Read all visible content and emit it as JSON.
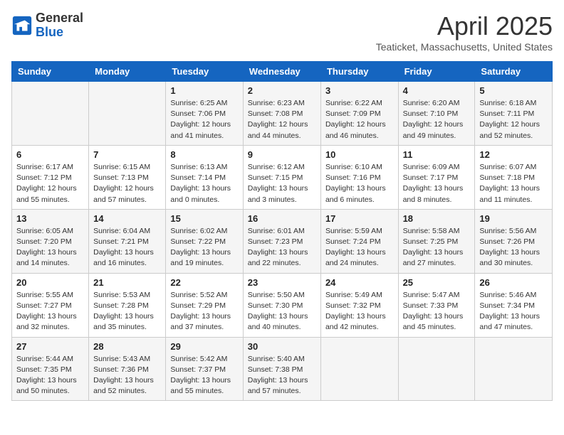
{
  "header": {
    "logo_general": "General",
    "logo_blue": "Blue",
    "month_title": "April 2025",
    "location": "Teaticket, Massachusetts, United States"
  },
  "days_of_week": [
    "Sunday",
    "Monday",
    "Tuesday",
    "Wednesday",
    "Thursday",
    "Friday",
    "Saturday"
  ],
  "weeks": [
    [
      {
        "day": "",
        "info": ""
      },
      {
        "day": "",
        "info": ""
      },
      {
        "day": "1",
        "info": "Sunrise: 6:25 AM\nSunset: 7:06 PM\nDaylight: 12 hours\nand 41 minutes."
      },
      {
        "day": "2",
        "info": "Sunrise: 6:23 AM\nSunset: 7:08 PM\nDaylight: 12 hours\nand 44 minutes."
      },
      {
        "day": "3",
        "info": "Sunrise: 6:22 AM\nSunset: 7:09 PM\nDaylight: 12 hours\nand 46 minutes."
      },
      {
        "day": "4",
        "info": "Sunrise: 6:20 AM\nSunset: 7:10 PM\nDaylight: 12 hours\nand 49 minutes."
      },
      {
        "day": "5",
        "info": "Sunrise: 6:18 AM\nSunset: 7:11 PM\nDaylight: 12 hours\nand 52 minutes."
      }
    ],
    [
      {
        "day": "6",
        "info": "Sunrise: 6:17 AM\nSunset: 7:12 PM\nDaylight: 12 hours\nand 55 minutes."
      },
      {
        "day": "7",
        "info": "Sunrise: 6:15 AM\nSunset: 7:13 PM\nDaylight: 12 hours\nand 57 minutes."
      },
      {
        "day": "8",
        "info": "Sunrise: 6:13 AM\nSunset: 7:14 PM\nDaylight: 13 hours\nand 0 minutes."
      },
      {
        "day": "9",
        "info": "Sunrise: 6:12 AM\nSunset: 7:15 PM\nDaylight: 13 hours\nand 3 minutes."
      },
      {
        "day": "10",
        "info": "Sunrise: 6:10 AM\nSunset: 7:16 PM\nDaylight: 13 hours\nand 6 minutes."
      },
      {
        "day": "11",
        "info": "Sunrise: 6:09 AM\nSunset: 7:17 PM\nDaylight: 13 hours\nand 8 minutes."
      },
      {
        "day": "12",
        "info": "Sunrise: 6:07 AM\nSunset: 7:18 PM\nDaylight: 13 hours\nand 11 minutes."
      }
    ],
    [
      {
        "day": "13",
        "info": "Sunrise: 6:05 AM\nSunset: 7:20 PM\nDaylight: 13 hours\nand 14 minutes."
      },
      {
        "day": "14",
        "info": "Sunrise: 6:04 AM\nSunset: 7:21 PM\nDaylight: 13 hours\nand 16 minutes."
      },
      {
        "day": "15",
        "info": "Sunrise: 6:02 AM\nSunset: 7:22 PM\nDaylight: 13 hours\nand 19 minutes."
      },
      {
        "day": "16",
        "info": "Sunrise: 6:01 AM\nSunset: 7:23 PM\nDaylight: 13 hours\nand 22 minutes."
      },
      {
        "day": "17",
        "info": "Sunrise: 5:59 AM\nSunset: 7:24 PM\nDaylight: 13 hours\nand 24 minutes."
      },
      {
        "day": "18",
        "info": "Sunrise: 5:58 AM\nSunset: 7:25 PM\nDaylight: 13 hours\nand 27 minutes."
      },
      {
        "day": "19",
        "info": "Sunrise: 5:56 AM\nSunset: 7:26 PM\nDaylight: 13 hours\nand 30 minutes."
      }
    ],
    [
      {
        "day": "20",
        "info": "Sunrise: 5:55 AM\nSunset: 7:27 PM\nDaylight: 13 hours\nand 32 minutes."
      },
      {
        "day": "21",
        "info": "Sunrise: 5:53 AM\nSunset: 7:28 PM\nDaylight: 13 hours\nand 35 minutes."
      },
      {
        "day": "22",
        "info": "Sunrise: 5:52 AM\nSunset: 7:29 PM\nDaylight: 13 hours\nand 37 minutes."
      },
      {
        "day": "23",
        "info": "Sunrise: 5:50 AM\nSunset: 7:30 PM\nDaylight: 13 hours\nand 40 minutes."
      },
      {
        "day": "24",
        "info": "Sunrise: 5:49 AM\nSunset: 7:32 PM\nDaylight: 13 hours\nand 42 minutes."
      },
      {
        "day": "25",
        "info": "Sunrise: 5:47 AM\nSunset: 7:33 PM\nDaylight: 13 hours\nand 45 minutes."
      },
      {
        "day": "26",
        "info": "Sunrise: 5:46 AM\nSunset: 7:34 PM\nDaylight: 13 hours\nand 47 minutes."
      }
    ],
    [
      {
        "day": "27",
        "info": "Sunrise: 5:44 AM\nSunset: 7:35 PM\nDaylight: 13 hours\nand 50 minutes."
      },
      {
        "day": "28",
        "info": "Sunrise: 5:43 AM\nSunset: 7:36 PM\nDaylight: 13 hours\nand 52 minutes."
      },
      {
        "day": "29",
        "info": "Sunrise: 5:42 AM\nSunset: 7:37 PM\nDaylight: 13 hours\nand 55 minutes."
      },
      {
        "day": "30",
        "info": "Sunrise: 5:40 AM\nSunset: 7:38 PM\nDaylight: 13 hours\nand 57 minutes."
      },
      {
        "day": "",
        "info": ""
      },
      {
        "day": "",
        "info": ""
      },
      {
        "day": "",
        "info": ""
      }
    ]
  ]
}
